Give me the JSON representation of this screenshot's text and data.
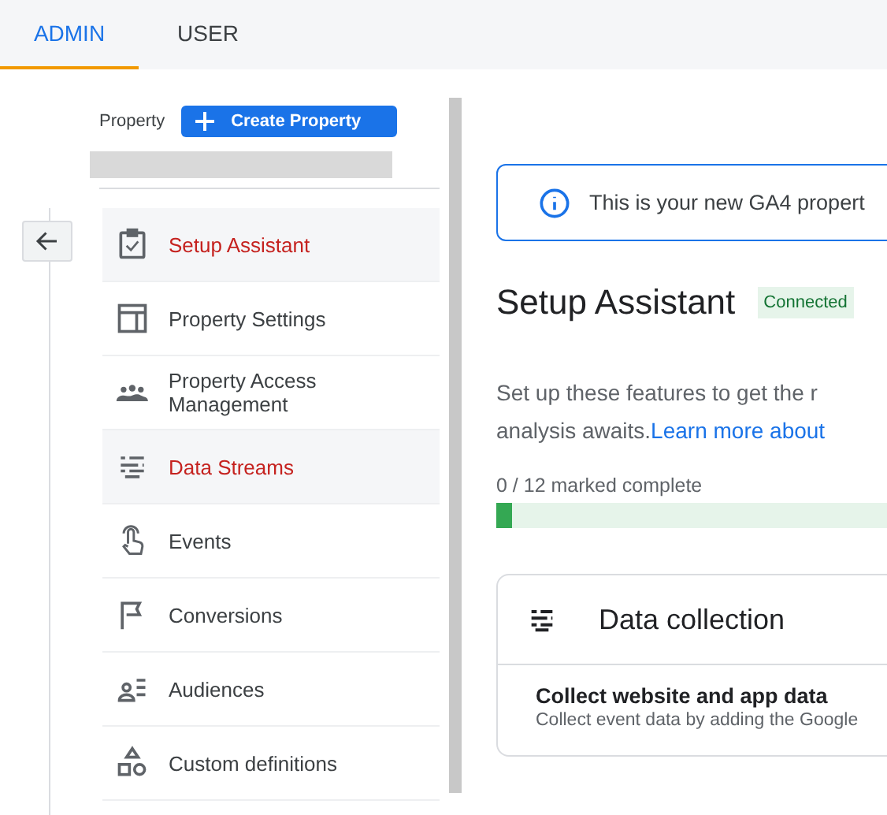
{
  "tabs": [
    {
      "label": "ADMIN",
      "selected": true
    },
    {
      "label": "USER",
      "selected": false
    }
  ],
  "property": {
    "label": "Property",
    "create_button": "Create Property"
  },
  "nav": [
    {
      "label": "Setup Assistant",
      "selected": true
    },
    {
      "label": "Property Settings",
      "selected": false
    },
    {
      "label": "Property Access Management",
      "selected": false
    },
    {
      "label": "Data Streams",
      "selected": true
    },
    {
      "label": "Events",
      "selected": false
    },
    {
      "label": "Conversions",
      "selected": false
    },
    {
      "label": "Audiences",
      "selected": false
    },
    {
      "label": "Custom definitions",
      "selected": false
    }
  ],
  "banner": {
    "text": "This is your new GA4 propert"
  },
  "heading": {
    "title": "Setup Assistant",
    "badge": "Connected"
  },
  "intro": {
    "line_1": "Set up these features to get the r",
    "line_2": "analysis awaits.",
    "link": "Learn more about"
  },
  "progress": {
    "label": "0 / 12 marked complete",
    "level": 0.03
  },
  "card": {
    "title": "Data collection",
    "item_title": "Collect website and app data",
    "item_text": "Collect event data by adding the Google"
  }
}
